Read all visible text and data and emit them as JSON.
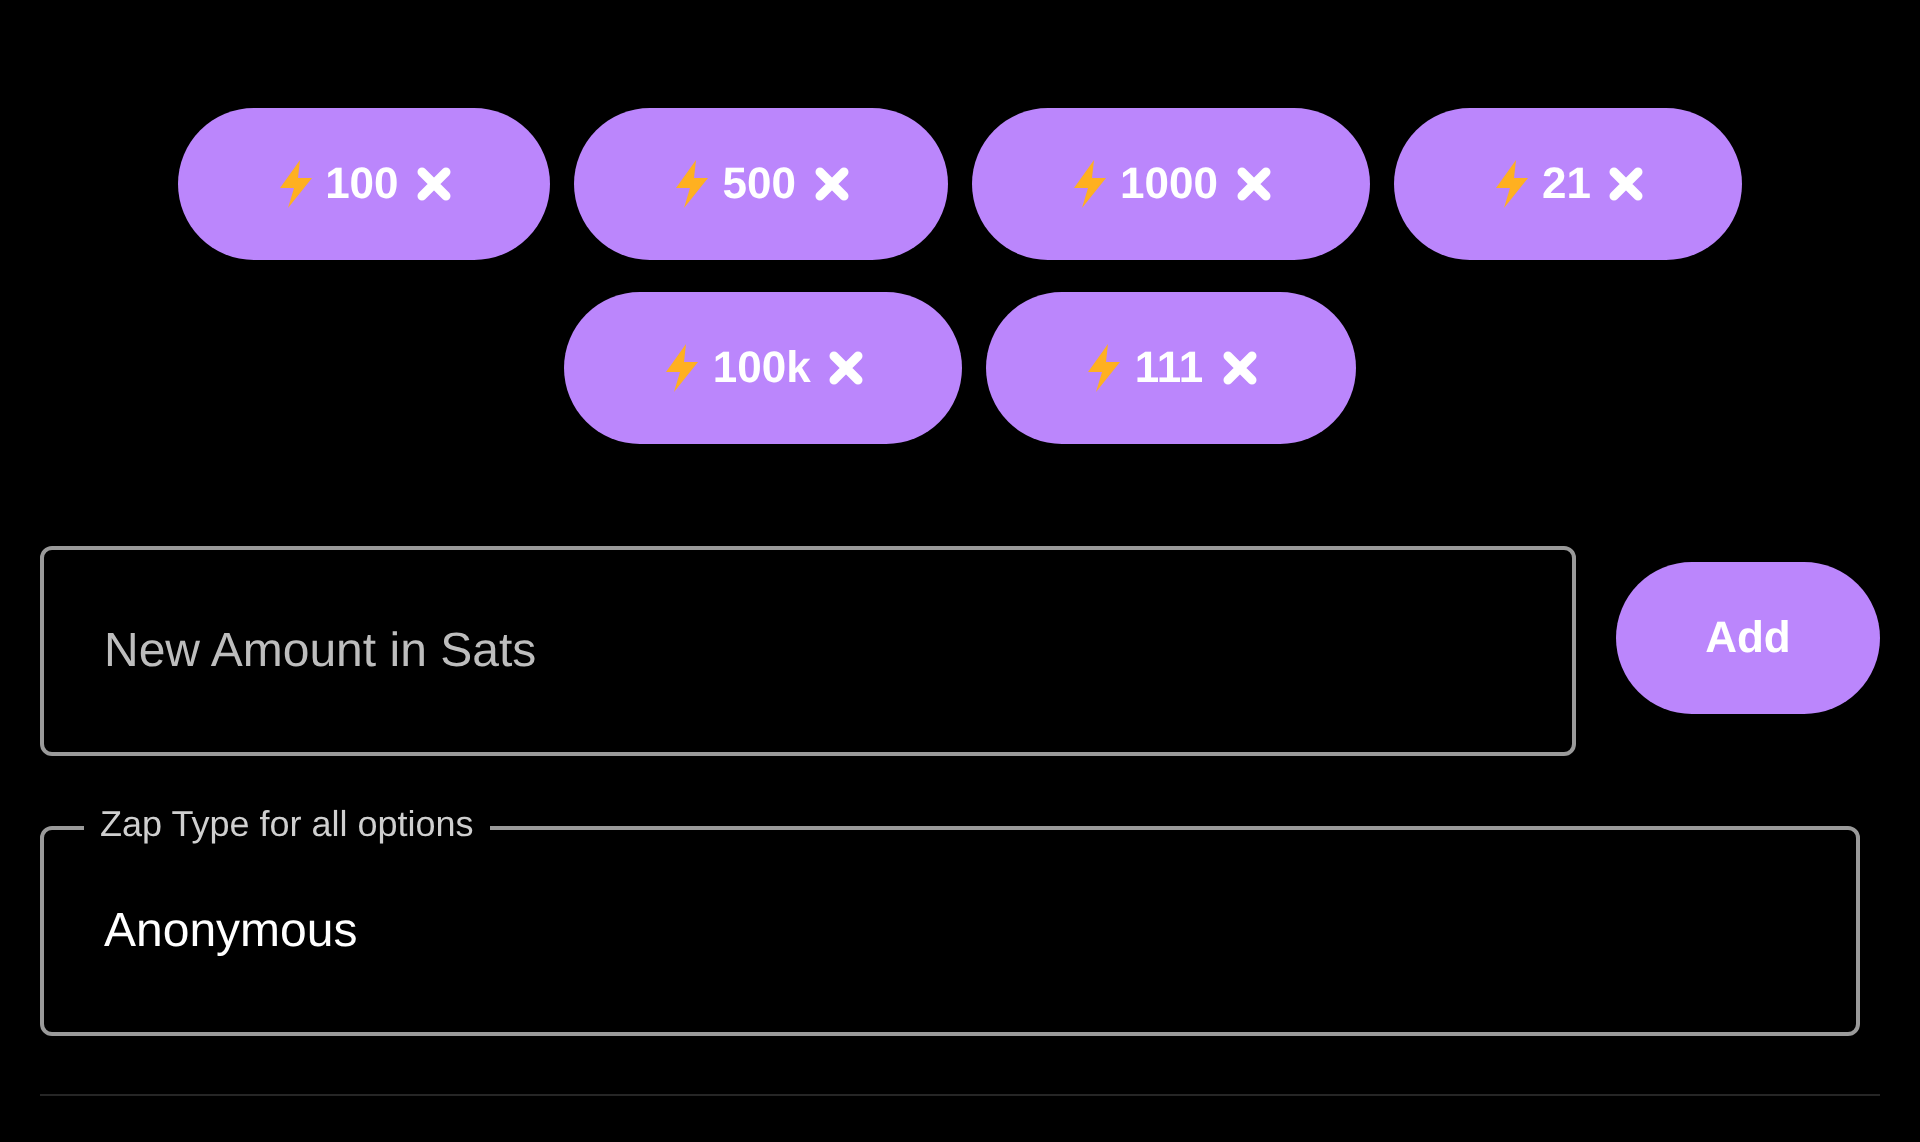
{
  "amounts": [
    {
      "amount": "100"
    },
    {
      "amount": "500"
    },
    {
      "amount": "1000"
    },
    {
      "amount": "21"
    },
    {
      "amount": "100k"
    },
    {
      "amount": "111"
    }
  ],
  "new_amount": {
    "placeholder": "New Amount in Sats"
  },
  "add_button": "Add",
  "zap_type": {
    "label": "Zap Type for all options",
    "value": "Anonymous"
  }
}
